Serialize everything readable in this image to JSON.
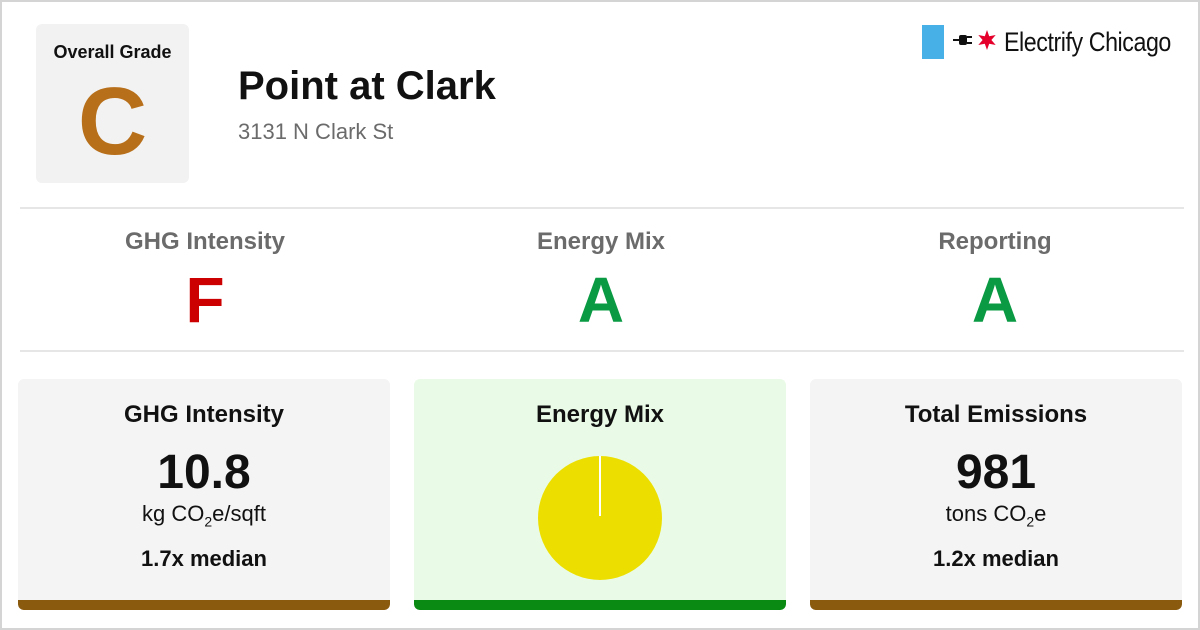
{
  "overall": {
    "label": "Overall Grade",
    "grade": "C",
    "color": "#b86f1a"
  },
  "building": {
    "name": "Point at Clark",
    "address": "3131 N Clark St"
  },
  "brand": {
    "name": "Electrify Chicago",
    "flag_color": "#47b1e7",
    "star_color": "#e4002b"
  },
  "subgrades": [
    {
      "label": "GHG Intensity",
      "grade": "F",
      "color": "#cc0000"
    },
    {
      "label": "Energy Mix",
      "grade": "A",
      "color": "#0a9a43"
    },
    {
      "label": "Reporting",
      "grade": "A",
      "color": "#0a9a43"
    }
  ],
  "cards": {
    "ghg": {
      "title": "GHG Intensity",
      "value": "10.8",
      "unit_prefix": "kg CO",
      "unit_sub": "2",
      "unit_suffix": "e/sqft",
      "median": "1.7x median",
      "bar_color": "#8a5a0f"
    },
    "mix": {
      "title": "Energy Mix",
      "bg": "#e9fbe6",
      "bar_color": "#0a8a12"
    },
    "total": {
      "title": "Total Emissions",
      "value": "981",
      "unit_prefix": "tons CO",
      "unit_sub": "2",
      "unit_suffix": "e",
      "median": "1.2x median",
      "bar_color": "#8a5a0f"
    }
  },
  "chart_data": {
    "type": "pie",
    "title": "",
    "slices": [
      {
        "value": 100,
        "color": "#ecdf00"
      }
    ]
  }
}
